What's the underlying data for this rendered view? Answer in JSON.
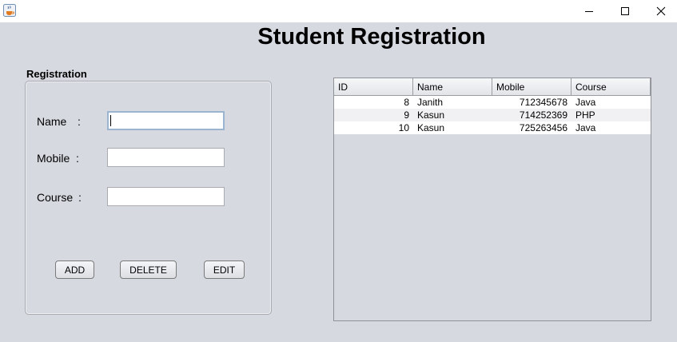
{
  "window": {
    "icon": "java-coffee-icon",
    "controls": [
      "minimize-icon",
      "maximize-icon",
      "close-icon"
    ]
  },
  "title": "Student Registration",
  "form": {
    "group_title": "Registration",
    "name_label": "Name",
    "mobile_label": "Mobile",
    "course_label": "Course",
    "colon": ":",
    "name_value": "",
    "mobile_value": "",
    "course_value": "",
    "buttons": {
      "add": "ADD",
      "delete": "DELETE",
      "edit": "EDIT"
    }
  },
  "table": {
    "columns": [
      "ID",
      "Name",
      "Mobile",
      "Course"
    ],
    "rows": [
      [
        "8",
        "Janith",
        "712345678",
        "Java"
      ],
      [
        "9",
        "Kasun",
        "714252369",
        "PHP"
      ],
      [
        "10",
        "Kasun",
        "725263456",
        "Java"
      ]
    ]
  },
  "colors": {
    "background": "#d6d9e0",
    "titlebar": "#ffffff",
    "focus_border": "#9bb4cf"
  }
}
